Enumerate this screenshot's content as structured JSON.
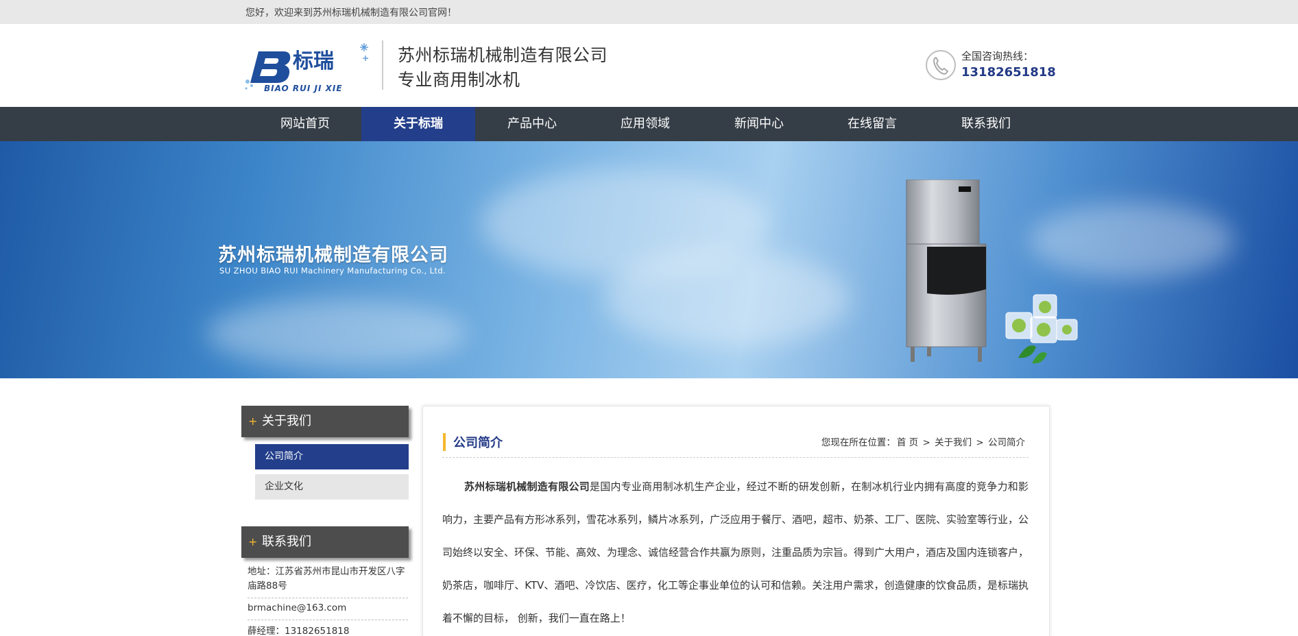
{
  "topbar": {
    "welcome": "您好，欢迎来到苏州标瑞机械制造有限公司官网！"
  },
  "header": {
    "company_name": "苏州标瑞机械制造有限公司",
    "slogan": "专业商用制冰机",
    "logo_text": "标瑞",
    "logo_pinyin": "BIAO RUI JI XIE",
    "hotline_label": "全国咨询热线：",
    "hotline_number": "13182651818"
  },
  "nav": {
    "items": [
      {
        "label": "网站首页",
        "active": false
      },
      {
        "label": "关于标瑞",
        "active": true
      },
      {
        "label": "产品中心",
        "active": false
      },
      {
        "label": "应用领域",
        "active": false
      },
      {
        "label": "新闻中心",
        "active": false
      },
      {
        "label": "在线留言",
        "active": false
      },
      {
        "label": "联系我们",
        "active": false
      }
    ]
  },
  "banner": {
    "title": "苏州标瑞机械制造有限公司",
    "subtitle": "SU ZHOU BIAO RUI Machinery Manufacturing Co., Ltd."
  },
  "sidebar": {
    "about_heading": "关于我们",
    "about_items": [
      {
        "label": "公司简介",
        "active": true
      },
      {
        "label": "企业文化",
        "active": false
      }
    ],
    "contact_heading": "联系我们",
    "contact": {
      "address": "地址：江苏省苏州市昆山市开发区八字庙路88号",
      "email": "brmachine@163.com",
      "manager": "薛经理：13182651818"
    },
    "plus_symbol": "+"
  },
  "main": {
    "title": "公司简介",
    "breadcrumb_prefix": "您现在所在位置：",
    "breadcrumb": [
      "首 页",
      "关于我们",
      "公司简介"
    ],
    "breadcrumb_sep": ">",
    "intro_bold": "苏州标瑞机械制造有限公司",
    "intro_text": "是国内专业商用制冰机生产企业，经过不断的研发创新，在制冰机行业内拥有高度的竞争力和影响力，主要产品有方形冰系列，雪花冰系列，鳞片冰系列，广泛应用于餐厅、酒吧，超市、奶茶、工厂、医院、实验室等行业，公司始终以安全、环保、节能、高效、为理念、诚信经营合作共赢为原则，注重品质为宗旨。得到广大用户，酒店及国内连锁客户，奶茶店，咖啡厅、KTV、酒吧、冷饮店、医疗，化工等企事业单位的认可和信赖。关注用户需求，创造健康的饮食品质，是标瑞执着不懈的目标， 创新，我们一直在路上！"
  },
  "colors": {
    "nav_bg": "#353d46",
    "accent_blue": "#233f8b",
    "accent_yellow": "#f5b82e"
  }
}
